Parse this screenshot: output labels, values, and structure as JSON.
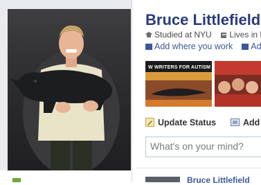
{
  "profile": {
    "name": "Bruce Littlefield",
    "studied": "Studied at NYU",
    "lives": "Lives in N",
    "add_work_link": "Add where you work",
    "add_link_2": "Add"
  },
  "photos": {
    "thumb1_caption": "W WRITERS FOR AUTISM"
  },
  "publisher": {
    "tabs": [
      {
        "label": "Update Status"
      },
      {
        "label": "Add Ph"
      }
    ],
    "status_placeholder": "What's on your mind?"
  },
  "feed": {
    "story_author": "Bruce Littlefield"
  },
  "colors": {
    "link_blue": "#3b5998",
    "name_blue": "#2a3a7c"
  }
}
